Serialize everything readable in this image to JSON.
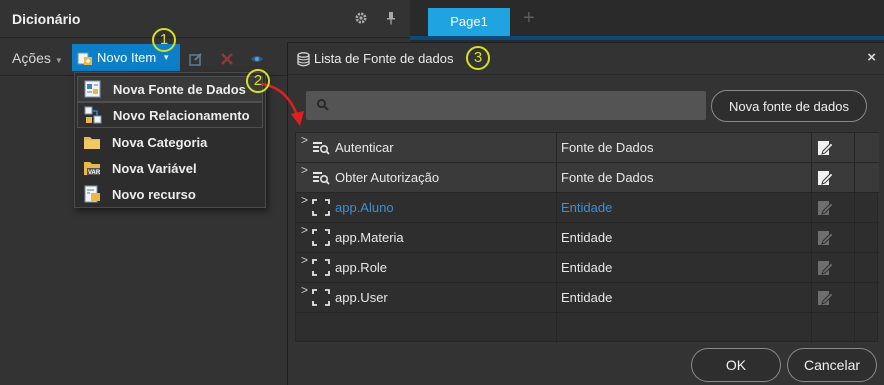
{
  "dictionary": {
    "title": "Dicionário",
    "toolbar": {
      "acoes_label": "Ações",
      "novo_item_label": "Novo Item"
    },
    "menu_items": [
      {
        "label": "Nova Fonte de Dados",
        "icon": "datasource-icon"
      },
      {
        "label": "Novo Relacionamento",
        "icon": "relationship-icon"
      },
      {
        "label": "Nova Categoria",
        "icon": "folder-icon"
      },
      {
        "label": "Nova Variável",
        "icon": "variable-icon"
      },
      {
        "label": "Novo recurso",
        "icon": "resource-icon"
      }
    ]
  },
  "page_tabs": {
    "active": "Page1"
  },
  "callouts": [
    "1",
    "2",
    "3"
  ],
  "dialog": {
    "title": "Lista de Fonte de dados",
    "search_placeholder": "",
    "new_source_button": "Nova fonte de dados",
    "rows": [
      {
        "name": "Autenticar",
        "type": "Fonte de Dados",
        "link": false
      },
      {
        "name": "Obter Autorização",
        "type": "Fonte de Dados",
        "link": false
      },
      {
        "name": "app.Aluno",
        "type": "Entidade",
        "link": true
      },
      {
        "name": "app.Materia",
        "type": "Entidade",
        "link": false
      },
      {
        "name": "app.Role",
        "type": "Entidade",
        "link": false
      },
      {
        "name": "app.User",
        "type": "Entidade",
        "link": false
      }
    ],
    "ok_button": "OK",
    "cancel_button": "Cancelar"
  },
  "colors": {
    "accent": "#1fa4e0",
    "callout": "#d8e026",
    "link": "#3d8fd6",
    "arrow": "#e02020"
  }
}
